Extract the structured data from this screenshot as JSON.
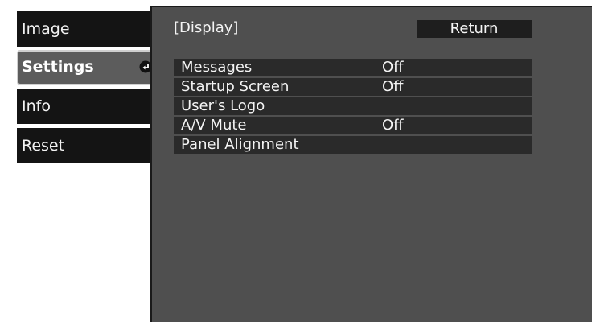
{
  "menu": {
    "items": [
      {
        "label": "Image"
      },
      {
        "label": "Settings"
      },
      {
        "label": "Info"
      },
      {
        "label": "Reset"
      }
    ],
    "selected": "Settings"
  },
  "panel": {
    "title": "[Display]",
    "return_label": "Return",
    "rows": [
      {
        "label": "Messages",
        "value": "Off"
      },
      {
        "label": "Startup Screen",
        "value": "Off"
      },
      {
        "label": "User's Logo",
        "value": ""
      },
      {
        "label": "A/V Mute",
        "value": "Off"
      },
      {
        "label": "Panel Alignment",
        "value": ""
      }
    ]
  },
  "icons": {
    "selected_tab_icon": "enter-icon"
  },
  "colors": {
    "panel_bg": "#4f4f4f",
    "row_bg": "#2a2a2a",
    "tab_bg": "#141414",
    "selected_tab_bg": "#5c5c5c",
    "text": "#f4f4f4"
  }
}
